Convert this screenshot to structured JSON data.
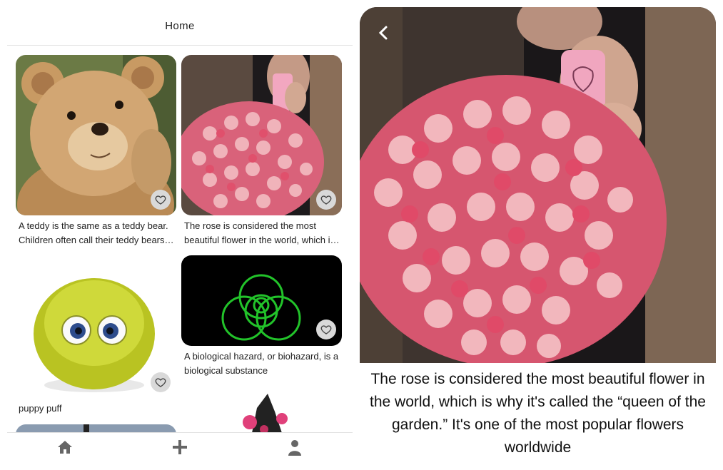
{
  "header": {
    "title": "Home"
  },
  "feed": {
    "cards": [
      {
        "caption": "A teddy is the same as a teddy bear. Children often call their teddy bears by name",
        "image": "teddy-bear"
      },
      {
        "caption": "The rose is considered the most beautiful flower in the world, which is why it's called the queen",
        "image": "rose-bouquet"
      },
      {
        "caption": "puppy puff",
        "image": "puffball-creature"
      },
      {
        "caption": "A biological hazard, or biohazard, is a biological substance",
        "image": "biohazard-symbol"
      }
    ]
  },
  "tabbar": {
    "items": [
      "home-icon",
      "add-icon",
      "profile-icon"
    ]
  },
  "detail": {
    "image": "rose-bouquet",
    "description": "The rose is considered the most beautiful flower in the world, which is why it's called the “queen of the garden.” It's one of the most popular flowers worldwide"
  },
  "colors": {
    "like_bg": "#d9d9d9",
    "icon_gray": "#666666",
    "biohazard_green": "#22c32a"
  }
}
